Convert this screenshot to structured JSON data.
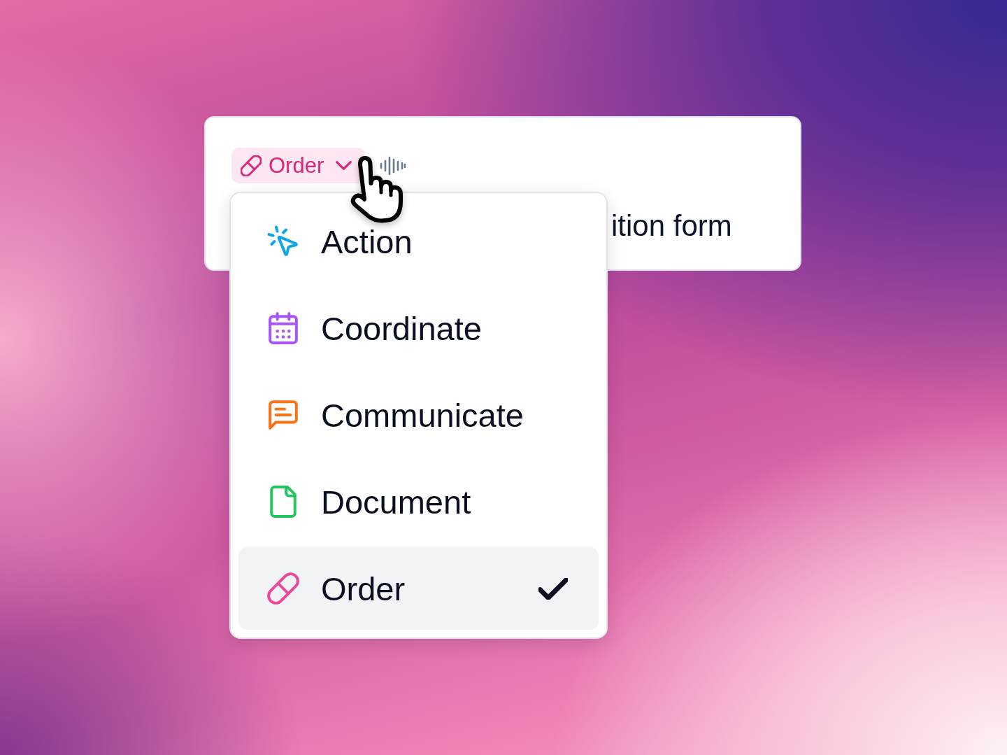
{
  "card": {
    "type_chip": {
      "label": "Order",
      "kind": "order",
      "expanded": true
    },
    "title": "ition form"
  },
  "dropdown": {
    "items": [
      {
        "label": "Action",
        "kind": "action",
        "selected": false
      },
      {
        "label": "Coordinate",
        "kind": "coordinate",
        "selected": false
      },
      {
        "label": "Communicate",
        "kind": "communicate",
        "selected": false
      },
      {
        "label": "Document",
        "kind": "document",
        "selected": false
      },
      {
        "label": "Order",
        "kind": "order",
        "selected": true
      }
    ]
  }
}
